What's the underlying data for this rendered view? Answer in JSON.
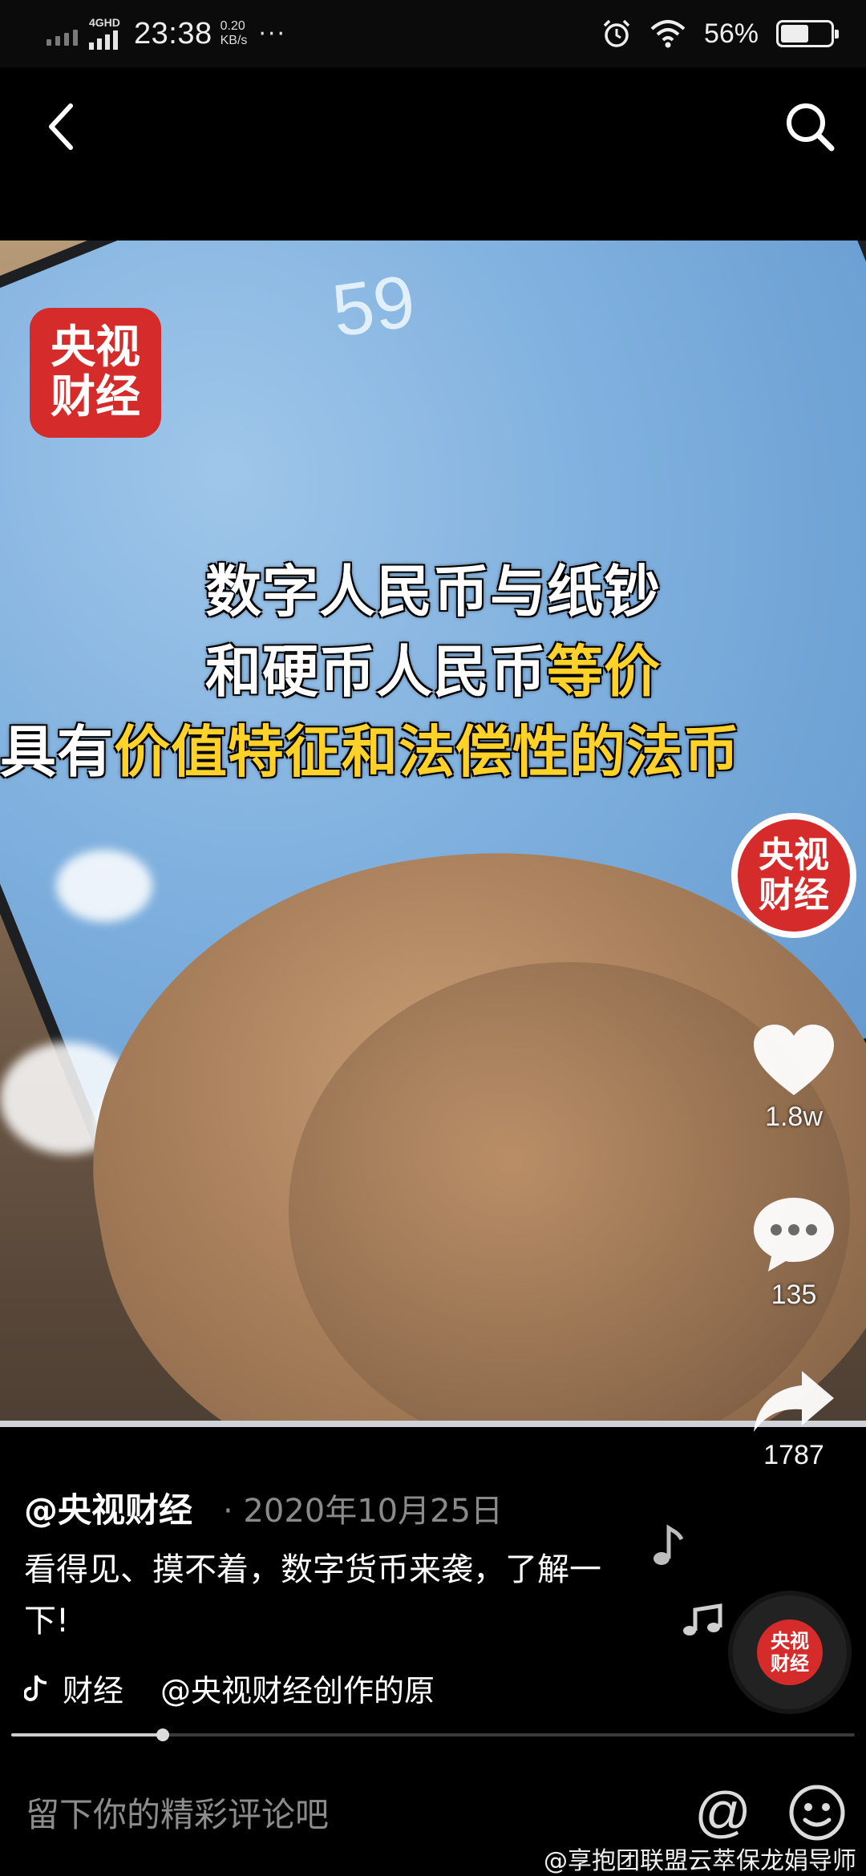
{
  "status_bar": {
    "network": "4GHD",
    "time": "23:38",
    "speed_value": "0.20",
    "speed_unit": "KB/s",
    "more": "···",
    "battery_percent": "56%",
    "battery_level": 0.56
  },
  "video": {
    "logo_line1": "央视",
    "logo_line2": "财经",
    "screen_clock": "59",
    "caption_line1": "数字人民币与纸钞",
    "caption_line2_a": "和硬币人民币",
    "caption_line2_b": "等价",
    "caption_line3_a": "具有",
    "caption_line3_b": "价值特征和法偿性的法币"
  },
  "actions": {
    "avatar_line1": "央视",
    "avatar_line2": "财经",
    "likes": "1.8w",
    "comments": "135",
    "shares": "1787"
  },
  "post": {
    "author": "@央视财经",
    "date": "· 2020年10月25日",
    "description": "看得见、摸不着，数字货币来袭，了解一下!",
    "tag": "财经",
    "music_source": "@央视财经创作的原",
    "progress": 0.18
  },
  "comment_bar": {
    "placeholder": "留下你的精彩评论吧",
    "at_symbol": "@"
  },
  "watermark": "@享抱团联盟云萃保龙娟导师"
}
